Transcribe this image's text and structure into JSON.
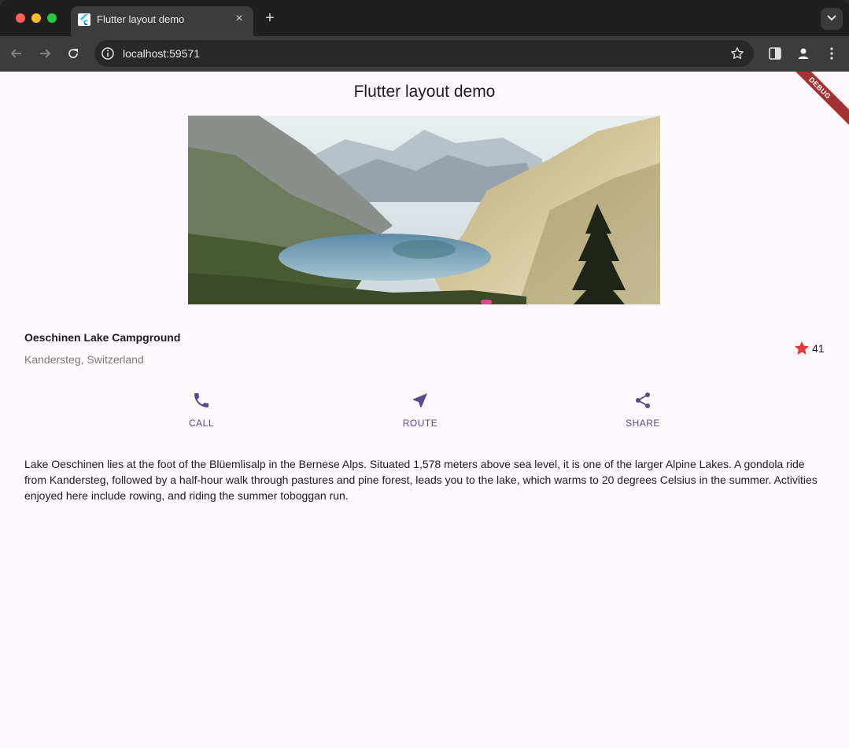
{
  "browser": {
    "tab_title": "Flutter layout demo",
    "tab_close": "×",
    "new_tab": "+",
    "url": "localhost:59571"
  },
  "app": {
    "title": "Flutter layout demo",
    "debug_banner": "DEBUG"
  },
  "place": {
    "name": "Oeschinen Lake Campground",
    "location": "Kandersteg, Switzerland",
    "rating_count": "41"
  },
  "actions": [
    {
      "label": "CALL",
      "icon": "phone-icon"
    },
    {
      "label": "ROUTE",
      "icon": "navigation-icon"
    },
    {
      "label": "SHARE",
      "icon": "share-icon"
    }
  ],
  "description": "Lake Oeschinen lies at the foot of the Blüemlisalp in the Bernese Alps. Situated 1,578 meters above sea level, it is one of the larger Alpine Lakes. A gondola ride from Kandersteg, followed by a half-hour walk through pastures and pine forest, leads you to the lake, which warms to 20 degrees Celsius in the summer. Activities enjoyed here include rowing, and riding the summer toboggan run.",
  "colors": {
    "accent": "#584a8a",
    "star": "#e53935",
    "page_background": "#fef7fb",
    "debug_banner": "#a33235"
  }
}
